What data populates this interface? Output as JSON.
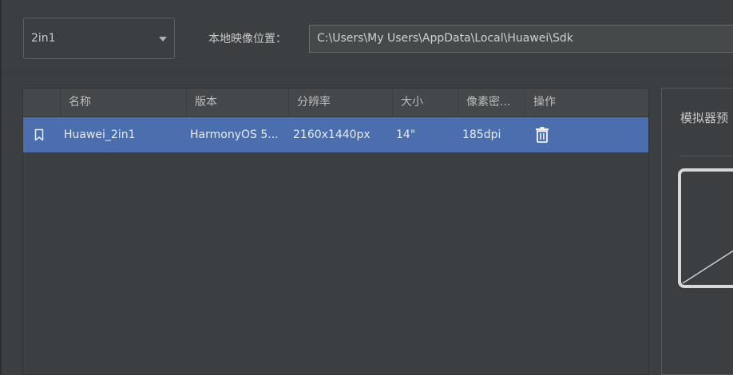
{
  "device_selector": {
    "value": "2in1"
  },
  "image_location": {
    "label": "本地映像位置：",
    "value": "C:\\Users\\My Users\\AppData\\Local\\Huawei\\Sdk"
  },
  "table": {
    "columns": [
      "名称",
      "版本",
      "分辨率",
      "大小",
      "像素密...",
      "操作"
    ],
    "rows": [
      {
        "name": "Huawei_2in1",
        "version": "HarmonyOS 5...",
        "resolution": "2160x1440px",
        "size": "14\"",
        "density": "185dpi",
        "action_icon": "trash-icon",
        "selected": true
      }
    ]
  },
  "preview": {
    "title": "模拟器预"
  },
  "colors": {
    "background": "#3c3f41",
    "selection": "#4b6eaf",
    "header": "#45484a"
  }
}
